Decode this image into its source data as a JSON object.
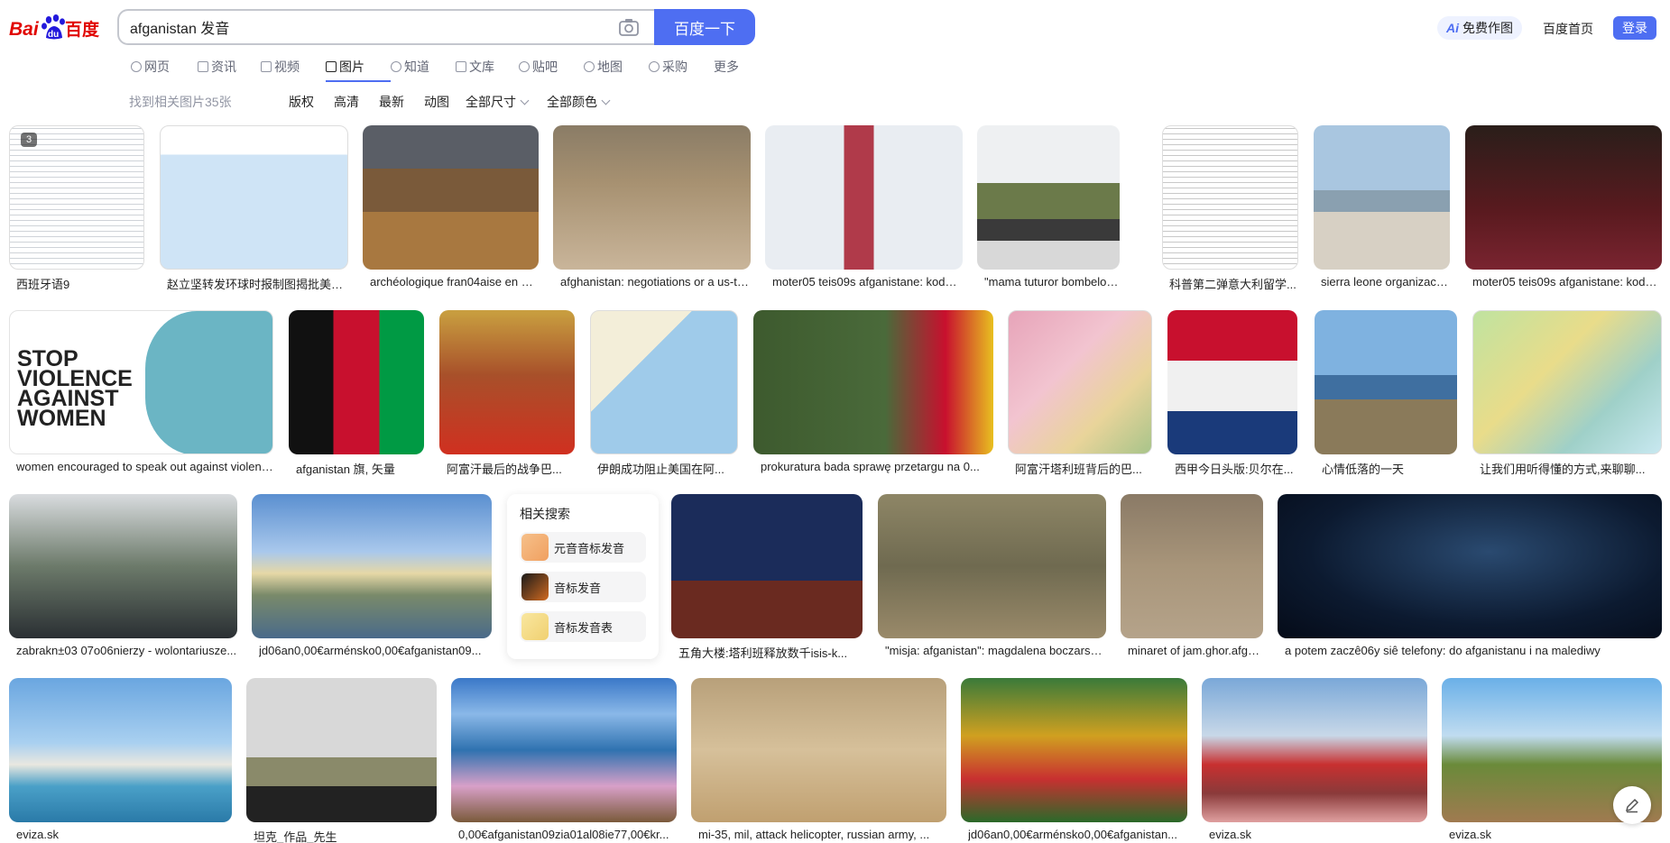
{
  "logo": {
    "text": "Bai",
    "text2": "百度",
    "paw": "du"
  },
  "search": {
    "query": "afganistan 发音",
    "button": "百度一下"
  },
  "header": {
    "ai_draw": "免费作图",
    "ai_icon_text": "Ai",
    "home": "百度首页",
    "login": "登录"
  },
  "tabs": [
    {
      "label": "网页",
      "icon": "search-icon"
    },
    {
      "label": "资讯",
      "icon": "news-icon"
    },
    {
      "label": "视频",
      "icon": "video-icon"
    },
    {
      "label": "图片",
      "icon": "image-icon",
      "active": true
    },
    {
      "label": "知道",
      "icon": "question-icon"
    },
    {
      "label": "文库",
      "icon": "doc-icon"
    },
    {
      "label": "贴吧",
      "icon": "tieba-icon"
    },
    {
      "label": "地图",
      "icon": "map-icon"
    },
    {
      "label": "采购",
      "icon": "shop-icon"
    },
    {
      "label": "更多"
    }
  ],
  "filters": {
    "result_count": "找到相关图片35张",
    "copyright": "版权",
    "hd": "高清",
    "latest": "最新",
    "animated": "动图",
    "size": "全部尺寸",
    "color": "全部颜色"
  },
  "rows": [
    [
      {
        "caption": "西班牙语9",
        "badge": "3"
      },
      {
        "caption": "赵立坚转发环球时报制图揭批美军..."
      },
      {
        "caption": "archéologique fran04aise en afghan..."
      },
      {
        "caption": "afghanistan: negotiations or a us-ta..."
      },
      {
        "caption": "moter05 teis09s afganistane: kodėl..."
      },
      {
        "caption": "\"mama tuturor bombelor\", lansata..."
      },
      {
        "caption": "科普第二弹意大利留学..."
      },
      {
        "caption": "sierra leone organizace spo..."
      },
      {
        "caption": "moter05 teis09s afganistane: kodėl..."
      }
    ],
    [
      {
        "caption": "women encouraged to speak out against violence"
      },
      {
        "caption": "afganistan 旗, 矢量"
      },
      {
        "caption": "阿富汗最后的战争巴..."
      },
      {
        "caption": "伊朗成功阻止美国在阿..."
      },
      {
        "caption": "prokuratura bada sprawę przetargu na 0..."
      },
      {
        "caption": "阿富汗塔利班背后的巴..."
      },
      {
        "caption": "西甲今日头版:贝尔在..."
      },
      {
        "caption": "心情低落的一天"
      },
      {
        "caption": "让我们用听得懂的方式,来聊聊..."
      }
    ],
    [
      {
        "caption": "zabrakn±03 07o06nierzy - wolontariusze..."
      },
      {
        "caption": "jd06an0,00€arménsko0,00€afganistan09..."
      },
      {
        "caption": "五角大楼:塔利班释放数千isis-k..."
      },
      {
        "caption": "\"misja: afganistan\": magdalena boczarska..."
      },
      {
        "caption": "minaret of jam.ghor.afghan..."
      },
      {
        "caption": "a potem zaczê06y siê telefony: do afganistanu i na malediwy"
      }
    ],
    [
      {
        "caption": "eviza.sk"
      },
      {
        "caption": "坦克_作品_先生"
      },
      {
        "caption": "0,00€afganistan09zia01al08ie77,00€kr..."
      },
      {
        "caption": "mi-35, mil, attack helicopter, russian army, ..."
      },
      {
        "caption": "jd06an0,00€arménsko0,00€afganistan..."
      },
      {
        "caption": "eviza.sk"
      },
      {
        "caption": "eviza.sk"
      }
    ]
  ],
  "related": {
    "title": "相关搜索",
    "items": [
      {
        "label": "元音音标发音"
      },
      {
        "label": "音标发音"
      },
      {
        "label": "音标发音表"
      }
    ]
  },
  "colors": {
    "accent": "#4e6ef2",
    "logo_red": "#e10602",
    "logo_blue": "#2319dc"
  }
}
